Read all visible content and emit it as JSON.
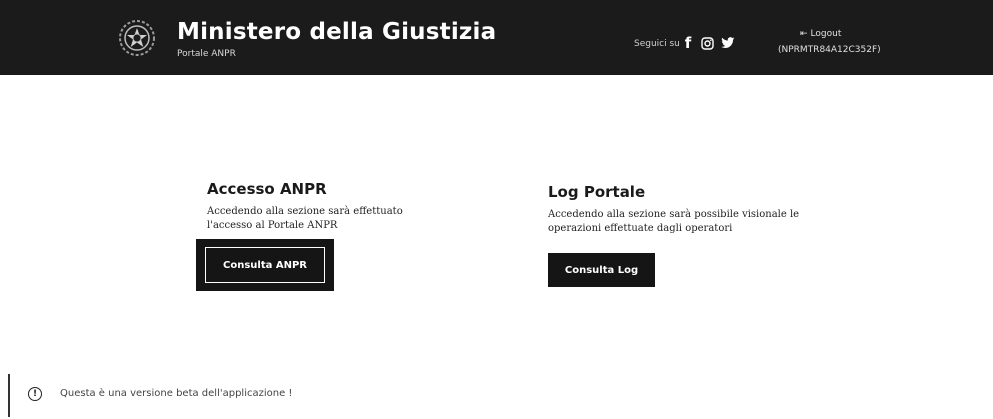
{
  "header": {
    "title": "Ministero della Giustizia",
    "subtitle": "Portale ANPR",
    "follow_label": "Seguici su",
    "social": [
      {
        "icon": "facebook-icon",
        "glyph": "f"
      },
      {
        "icon": "instagram-icon"
      },
      {
        "icon": "twitter-icon"
      }
    ],
    "logout_label": "Logout",
    "user_id": "(NPRMTR84A12C352F)"
  },
  "cards": [
    {
      "title": "Accesso ANPR",
      "description": "Accedendo alla sezione sarà effettuato l'accesso al Portale ANPR",
      "button_label": "Consulta ANPR"
    },
    {
      "title": "Log Portale",
      "description": "Accedendo alla sezione sarà possibile visionale le operazioni effettuate dagli operatori",
      "button_label": "Consulta Log"
    }
  ],
  "beta_notice": {
    "icon": "info-icon",
    "text": "Questa è una versione beta dell'applicazione !"
  },
  "colors": {
    "header_bg": "#1b1b1b",
    "button_bg": "#151515",
    "page_bg": "#ffffff"
  }
}
